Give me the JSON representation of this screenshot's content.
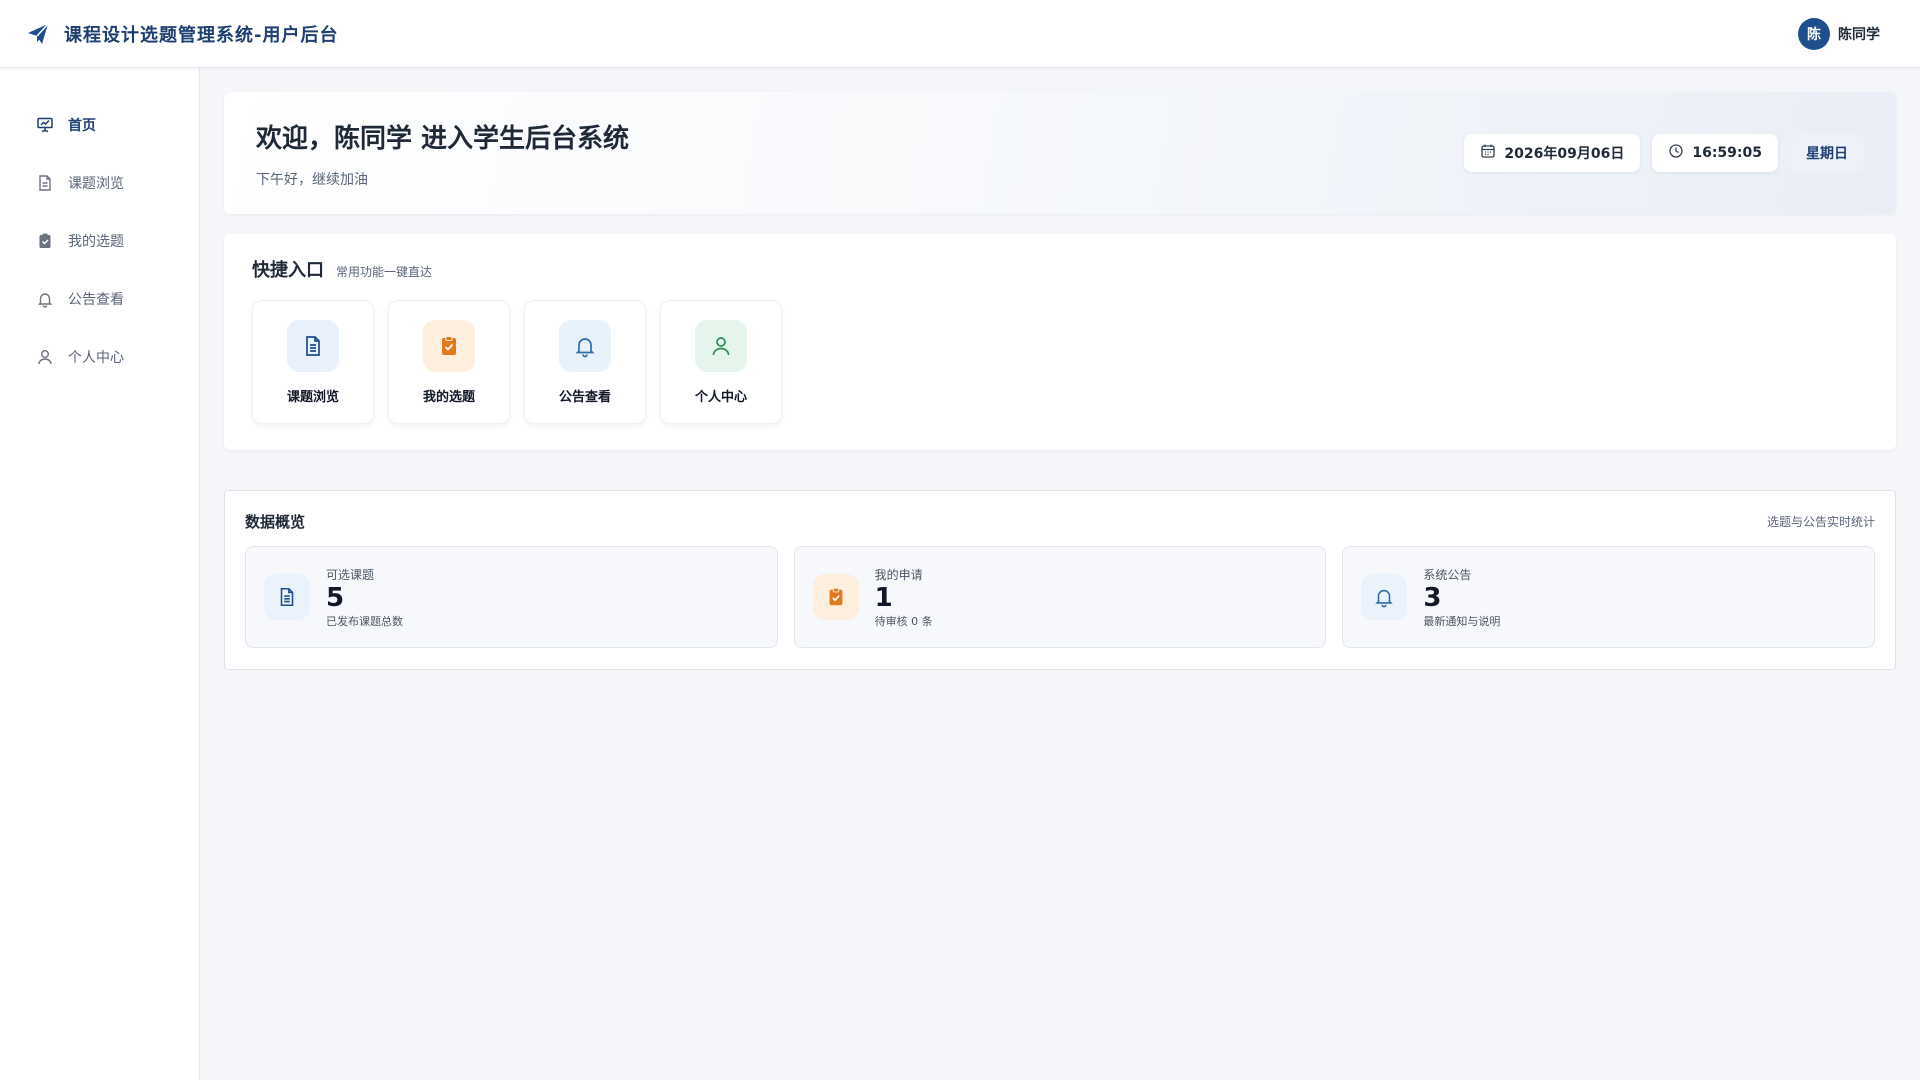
{
  "header": {
    "title": "课程设计选题管理系统-用户后台",
    "logo_icon": "paper-plane-icon",
    "user": {
      "avatar_text": "陈",
      "name": "陈同学"
    }
  },
  "sidebar": {
    "items": [
      {
        "label": "首页",
        "icon": "presentation-chart-icon",
        "active": true
      },
      {
        "label": "课题浏览",
        "icon": "document-icon"
      },
      {
        "label": "我的选题",
        "icon": "clipboard-check-icon"
      },
      {
        "label": "公告查看",
        "icon": "bell-icon"
      },
      {
        "label": "个人中心",
        "icon": "user-icon"
      }
    ]
  },
  "welcome": {
    "title": "欢迎，陈同学 进入学生后台系统",
    "subtitle": "下午好，继续加油",
    "date": "2026年09月06日",
    "time": "16:59:05",
    "weekday": "星期日"
  },
  "quick": {
    "title": "快捷入口",
    "subtitle": "常用功能一键直达",
    "tiles": [
      {
        "label": "课题浏览",
        "icon": "document-icon",
        "color": "#1f4e8c",
        "bg": "#e8f1fb"
      },
      {
        "label": "我的选题",
        "icon": "clipboard-check-icon",
        "color": "#e07a1f",
        "bg": "#fdeede"
      },
      {
        "label": "公告查看",
        "icon": "bell-icon",
        "color": "#2f6ea8",
        "bg": "#e8f2fb"
      },
      {
        "label": "个人中心",
        "icon": "user-icon",
        "color": "#2e8b57",
        "bg": "#e6f5ec"
      }
    ]
  },
  "overview": {
    "title": "数据概览",
    "note": "选题与公告实时统计",
    "stats": [
      {
        "label": "可选课题",
        "value": "5",
        "desc": "已发布课题总数",
        "icon": "document-icon",
        "color": "#1f4e8c",
        "bg": "#eaf2fb"
      },
      {
        "label": "我的申请",
        "value": "1",
        "desc": "待审核 0 条",
        "icon": "clipboard-check-icon",
        "color": "#e07a1f",
        "bg": "#fdeede"
      },
      {
        "label": "系统公告",
        "value": "3",
        "desc": "最新通知与说明",
        "icon": "bell-icon",
        "color": "#2f6ea8",
        "bg": "#eaf2fb"
      }
    ]
  }
}
